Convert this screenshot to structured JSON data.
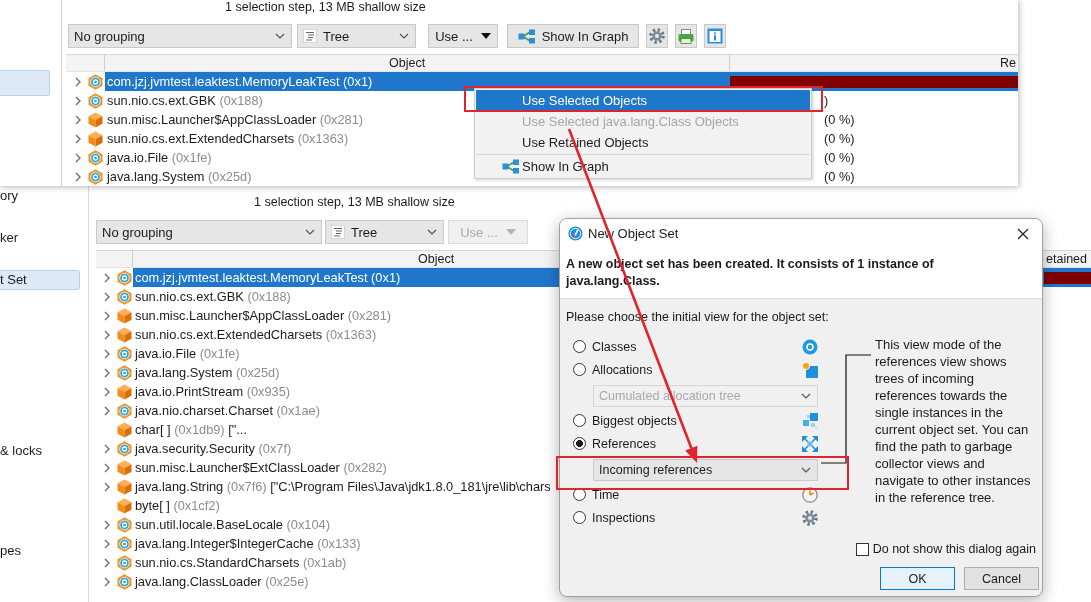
{
  "back_window": {
    "sidebar": {
      "items": [
        {
          "label": "ory",
          "selected": false
        },
        {
          "label": "ker",
          "selected": false
        },
        {
          "label": "t Set",
          "selected": true
        },
        {
          "label": "& locks",
          "selected": false
        },
        {
          "label": "pes",
          "selected": false
        }
      ]
    },
    "summary": "1 selection step, 13 MB shallow size",
    "toolbar": {
      "grouping": "No grouping",
      "view": "Tree",
      "use_button": {
        "label": "Use ...",
        "disabled": true
      }
    },
    "table": {
      "columns": [
        "Object",
        "etained"
      ],
      "rows": [
        {
          "kind": "class",
          "expandable": true,
          "name": "com.jzj.jvmtest.leaktest.MemoryLeakTest",
          "address": "(0x1)",
          "selected": true,
          "level": 1
        },
        {
          "kind": "class",
          "expandable": true,
          "name": "sun.nio.cs.ext.GBK",
          "address": "(0x188)",
          "selected": false
        },
        {
          "kind": "instance",
          "expandable": true,
          "name": "sun.misc.Launcher$AppClassLoader",
          "address": "(0x281)",
          "selected": false
        },
        {
          "kind": "instance",
          "expandable": true,
          "name": "sun.nio.cs.ext.ExtendedCharsets",
          "address": "(0x1363)",
          "selected": false
        },
        {
          "kind": "class",
          "expandable": true,
          "name": "java.io.File",
          "address": "(0x1fe)",
          "selected": false
        },
        {
          "kind": "class",
          "expandable": true,
          "name": "java.lang.System",
          "address": "(0x25d)",
          "selected": false
        },
        {
          "kind": "instance",
          "expandable": true,
          "name": "java.io.PrintStream",
          "address": "(0x935)",
          "selected": false
        },
        {
          "kind": "class",
          "expandable": true,
          "name": "java.nio.charset.Charset",
          "address": "(0x1ae)",
          "selected": false
        },
        {
          "kind": "instance",
          "expandable": false,
          "name": "char[ ]",
          "address": "(0x1db9)",
          "value": "[\"...",
          "selected": false
        },
        {
          "kind": "class",
          "expandable": true,
          "name": "java.security.Security",
          "address": "(0x7f)",
          "selected": false
        },
        {
          "kind": "instance",
          "expandable": true,
          "name": "sun.misc.Launcher$ExtClassLoader",
          "address": "(0x282)",
          "selected": false
        },
        {
          "kind": "instance",
          "expandable": true,
          "name": "java.lang.String",
          "address": "(0x7f6)",
          "value": "[\"C:\\Program Files\\Java\\jdk1.8.0_181\\jre\\lib\\chars",
          "selected": false
        },
        {
          "kind": "instance",
          "expandable": false,
          "name": "byte[ ]",
          "address": "(0x1cf2)",
          "selected": false
        },
        {
          "kind": "class",
          "expandable": true,
          "name": "sun.util.locale.BaseLocale",
          "address": "(0x104)",
          "selected": false
        },
        {
          "kind": "class",
          "expandable": true,
          "name": "java.lang.Integer$IntegerCache",
          "address": "(0x133)",
          "selected": false
        },
        {
          "kind": "class",
          "expandable": true,
          "name": "sun.nio.cs.StandardCharsets",
          "address": "(0x1ab)",
          "selected": false
        },
        {
          "kind": "class",
          "expandable": true,
          "name": "java.lang.ClassLoader",
          "address": "(0x25e)",
          "selected": false
        }
      ]
    }
  },
  "front_window": {
    "sidebar": {
      "items": [
        {
          "selected": true
        }
      ]
    },
    "summary": "1 selection step, 13 MB shallow size",
    "toolbar": {
      "grouping": "No grouping",
      "view": "Tree",
      "use_button": {
        "label": "Use ...",
        "disabled": false
      },
      "graph_button": "Show In Graph"
    },
    "table": {
      "columns": [
        "Object",
        "Re"
      ],
      "rows": [
        {
          "kind": "class",
          "expandable": true,
          "name": "com.jzj.jvmtest.leaktest.MemoryLeakTest",
          "address": "(0x1)",
          "selected": true,
          "level": 1
        },
        {
          "kind": "class",
          "expandable": true,
          "name": "sun.nio.cs.ext.GBK",
          "address": "(0x188)",
          "selected": false,
          "retained": ")"
        },
        {
          "kind": "instance",
          "expandable": true,
          "name": "sun.misc.Launcher$AppClassLoader",
          "address": "(0x281)",
          "selected": false,
          "retained": "(0 %)"
        },
        {
          "kind": "instance",
          "expandable": true,
          "name": "sun.nio.cs.ext.ExtendedCharsets",
          "address": "(0x1363)",
          "selected": false,
          "retained": "(0 %)"
        },
        {
          "kind": "class",
          "expandable": true,
          "name": "java.io.File",
          "address": "(0x1fe)",
          "selected": false,
          "retained": "(0 %)"
        },
        {
          "kind": "class",
          "expandable": true,
          "name": "java.lang.System",
          "address": "(0x25d)",
          "selected": false,
          "retained": "(0 %)"
        }
      ]
    }
  },
  "context_menu": {
    "items": [
      {
        "label": "Use Selected Objects",
        "kind": "plain",
        "selected": true,
        "disabled": false,
        "separator_before": false
      },
      {
        "label": "Use Selected java.lang.Class Objects",
        "kind": "plain",
        "selected": false,
        "disabled": true,
        "separator_before": false
      },
      {
        "label": "Use Retained Objects",
        "kind": "plain",
        "selected": false,
        "disabled": false,
        "separator_before": false
      },
      {
        "label": "Show In Graph",
        "kind": "icon",
        "selected": false,
        "disabled": false,
        "separator_before": true
      }
    ]
  },
  "dialog": {
    "title": "New Object Set",
    "message": "A new object set has been created. It consists of 1 instance of java.lang.Class.",
    "prompt": "Please choose the initial view for the object set:",
    "options": [
      {
        "label": "Classes",
        "kind": "classes",
        "selected": false
      },
      {
        "label": "Allocations",
        "kind": "allocations",
        "selected": false,
        "dropdown": {
          "value": "Cumulated allocation tree",
          "disabled": true
        }
      },
      {
        "label": "Biggest objects",
        "kind": "biggest",
        "selected": false
      },
      {
        "label": "References",
        "kind": "references",
        "selected": true,
        "dropdown": {
          "value": "Incoming references",
          "disabled": false
        }
      },
      {
        "label": "Time",
        "kind": "time",
        "selected": false
      },
      {
        "label": "Inspections",
        "kind": "inspections",
        "selected": false
      }
    ],
    "description": "This view mode of the references view shows trees of incoming references towards the single instances in the current object set. You can find the path to garbage collector views and navigate to other instances in the reference tree.",
    "checkbox": {
      "label": "Do not show this dialog again",
      "checked": false
    },
    "buttons": [
      {
        "label": "OK",
        "default": true
      },
      {
        "label": "Cancel",
        "default": false
      }
    ]
  }
}
